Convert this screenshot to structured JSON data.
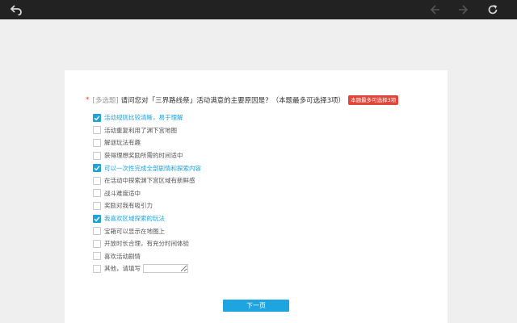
{
  "toolbar": {
    "back_icon": "back-arrow-icon",
    "prev_icon": "arrow-left-icon",
    "next_icon": "arrow-right-icon",
    "refresh_icon": "refresh-icon"
  },
  "question": {
    "required_mark": "*",
    "type_label": "[多选题]",
    "text": "请问您对「三界路线祭」活动满意的主要原因是？（本题最多可选择3项）",
    "limit_badge": "本题最多可选择3项"
  },
  "options": [
    {
      "label": "活动规则比较清晰，易于理解",
      "checked": true
    },
    {
      "label": "活动重复利用了渊下宫地图",
      "checked": false
    },
    {
      "label": "解谜玩法有趣",
      "checked": false
    },
    {
      "label": "获得理想奖励所需的时间适中",
      "checked": false
    },
    {
      "label": "可以一次性完成全部剧情和探索内容",
      "checked": true
    },
    {
      "label": "在活动中探索渊下宫区域有新鲜感",
      "checked": false
    },
    {
      "label": "战斗难度适中",
      "checked": false
    },
    {
      "label": "奖励对我有吸引力",
      "checked": false
    },
    {
      "label": "我喜欢区域探索的玩法",
      "checked": true
    },
    {
      "label": "宝箱可以显示在地图上",
      "checked": false
    },
    {
      "label": "开放时长合理，有充分时间体验",
      "checked": false
    },
    {
      "label": "喜欢活动剧情",
      "checked": false
    },
    {
      "label": "其他，请填写",
      "checked": false,
      "other": true
    }
  ],
  "other_input": {
    "value": "",
    "placeholder": ""
  },
  "next_button": {
    "label": "下一页"
  },
  "colors": {
    "accent": "#1ca3d8",
    "button": "#1ea4e1",
    "badge": "#e0463a"
  }
}
